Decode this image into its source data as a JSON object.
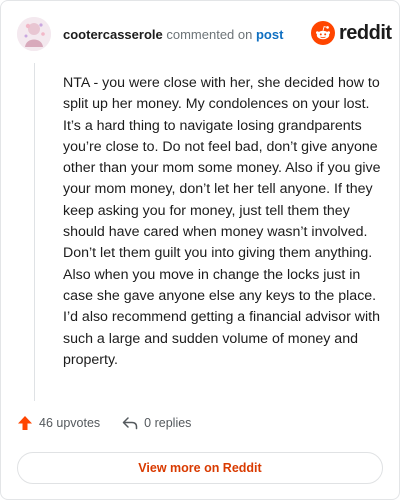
{
  "header": {
    "username": "cootercasserole",
    "action_text": "commented on",
    "target_link": "post",
    "logo_text": "reddit",
    "avatar_icon": "avatar-icon",
    "logo_icon": "reddit-snoo-icon"
  },
  "comment": {
    "body": "NTA - you were close with her, she decided how to split up her money. My condolences on your lost. It’s a hard thing to navigate losing grandparents you’re close to. Do not feel bad, don’t give anyone other than your mom some money. Also if you give your mom money, don’t let her tell anyone. If they keep asking you for money, just tell them they should have cared when money wasn’t involved. Don’t let them guilt you into giving them anything. Also when you move in change the locks just in case she gave anyone else any keys to the place. I’d also recommend getting a financial advisor with such a large and sudden volume of money and property."
  },
  "actions": {
    "upvotes": "46 upvotes",
    "replies": "0 replies",
    "upvote_icon": "upvote-arrow-icon",
    "reply_icon": "reply-arrow-icon"
  },
  "footer": {
    "view_more": "View more on Reddit"
  },
  "colors": {
    "brand": "#ff4500",
    "link": "#0f6fc1",
    "view_more_text": "#d93a00"
  }
}
